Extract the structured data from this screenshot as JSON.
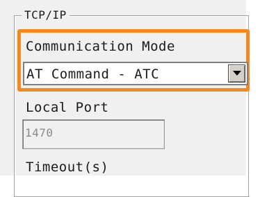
{
  "group": {
    "title": "TCP/IP"
  },
  "communication_mode": {
    "label": "Communication Mode",
    "selected": "AT Command - ATC",
    "dropdown_icon": "chevron-down-icon"
  },
  "local_port": {
    "label": "Local Port",
    "value": "1470"
  },
  "timeout": {
    "label": "Timeout(s)"
  },
  "colors": {
    "highlight": "#f48a1f",
    "panel": "#f0f0f0"
  }
}
